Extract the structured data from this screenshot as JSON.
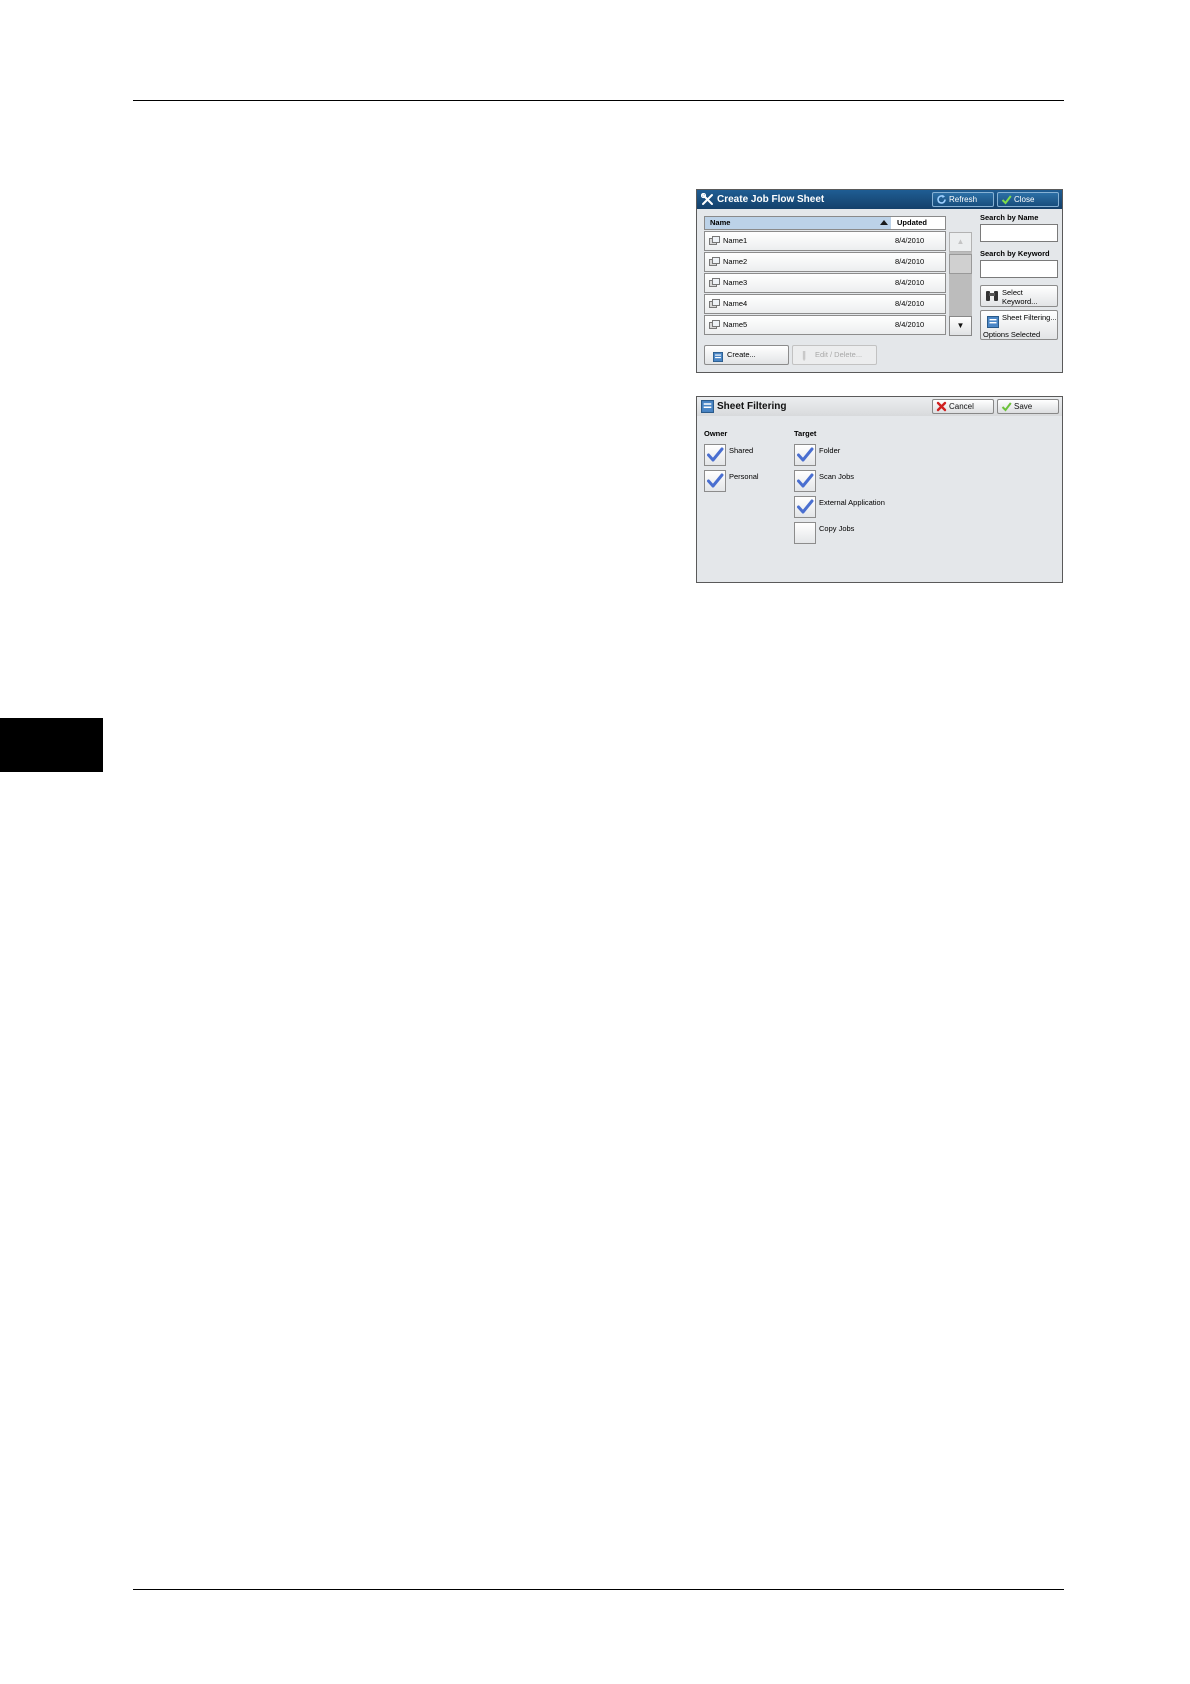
{
  "create_panel": {
    "title": "Create Job Flow Sheet",
    "refresh_label": "Refresh",
    "close_label": "Close",
    "columns": {
      "name": "Name",
      "updated": "Updated"
    },
    "rows": [
      {
        "name": "Name1",
        "updated": "8/4/2010"
      },
      {
        "name": "Name2",
        "updated": "8/4/2010"
      },
      {
        "name": "Name3",
        "updated": "8/4/2010"
      },
      {
        "name": "Name4",
        "updated": "8/4/2010"
      },
      {
        "name": "Name5",
        "updated": "8/4/2010"
      }
    ],
    "search_by_name_label": "Search by Name",
    "search_by_name_value": "",
    "search_by_keyword_label": "Search by Keyword",
    "search_by_keyword_value": "",
    "select_keyword_line1": "Select",
    "select_keyword_line2": "Keyword...",
    "sheet_filtering_label": "Sheet Filtering...",
    "sheet_filtering_status": "Options Selected",
    "create_label": "Create...",
    "edit_delete_label": "Edit / Delete..."
  },
  "filter_panel": {
    "title": "Sheet Filtering",
    "cancel_label": "Cancel",
    "save_label": "Save",
    "owner_label": "Owner",
    "target_label": "Target",
    "owner_options": [
      {
        "label": "Shared",
        "checked": true
      },
      {
        "label": "Personal",
        "checked": true
      }
    ],
    "target_options": [
      {
        "label": "Folder",
        "checked": true
      },
      {
        "label": "Scan Jobs",
        "checked": true
      },
      {
        "label": "External Application",
        "checked": true
      },
      {
        "label": "Copy Jobs",
        "checked": false
      }
    ]
  },
  "colors": {
    "title_bar": "#1f5d93",
    "header_highlight": "#bcd2e8",
    "checkmark": "#4a6fd0"
  }
}
